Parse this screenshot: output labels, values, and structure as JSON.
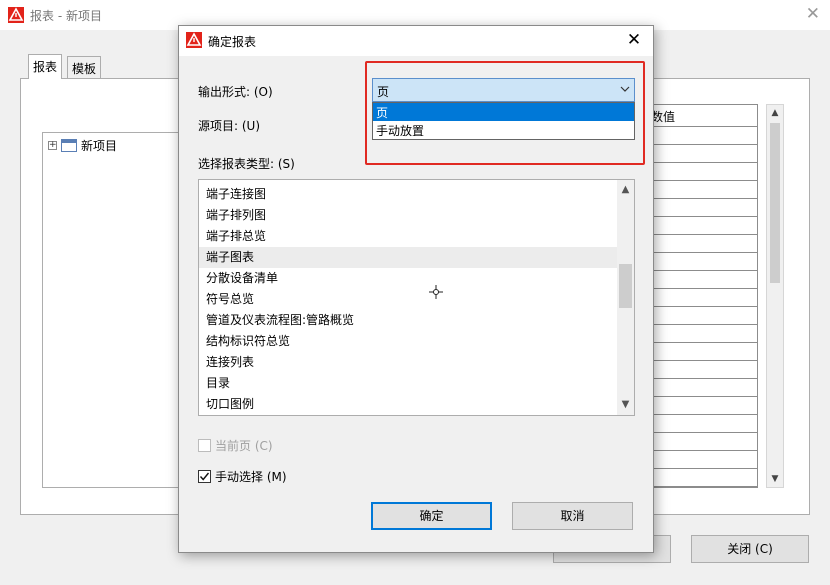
{
  "background_window": {
    "title": "报表 - 新项目",
    "close_glyph": "✕",
    "tabs": [
      "报表",
      "模板"
    ],
    "tree": {
      "expander": "+",
      "item": "新项目"
    },
    "table_header_fragment": "数值",
    "close_button": "关闭 (C)"
  },
  "dialog": {
    "title": "确定报表",
    "close_glyph": "✕",
    "output_form_label": "输出形式: (O)",
    "output_form_value": "页",
    "dropdown_options": [
      {
        "label": "页",
        "selected": true
      },
      {
        "label": "手动放置",
        "selected": false
      }
    ],
    "source_label": "源项目: (U)",
    "report_type_label": "选择报表类型: (S)",
    "report_types": [
      "端子连接图",
      "端子排列图",
      "端子排总览",
      "端子图表",
      "分散设备清单",
      "符号总览",
      "管道及仪表流程图:管路概览",
      "结构标识符总览",
      "连接列表",
      "目录",
      "切口图例"
    ],
    "hovered_item": "端子图表",
    "current_page_checkbox": {
      "label": "当前页 (C)",
      "checked": false,
      "enabled": false
    },
    "manual_select_checkbox": {
      "label": "手动选择 (M)",
      "checked": true,
      "enabled": true
    },
    "ok_button": "确定",
    "cancel_button": "取消"
  },
  "colors": {
    "highlight_box": "#e02a22",
    "selection": "#0078d7",
    "combo_focus": "#cce4f7",
    "app_icon": "#e2231a"
  },
  "icons": {
    "app": "eplan-warning-triangle-icon",
    "combo": "chevron-down-icon",
    "scroll_up": "chevron-up-icon",
    "scroll_down": "chevron-down-icon",
    "cursor": "move-crosshair-icon",
    "check": "checkmark-icon"
  }
}
